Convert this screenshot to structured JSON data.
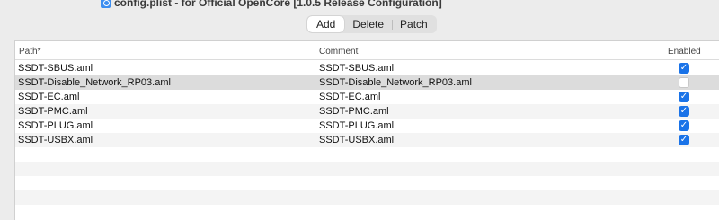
{
  "window": {
    "title": "config.plist - for Official OpenCore [1.0.5 Release Configuration]"
  },
  "tabs": [
    {
      "label": "Add",
      "active": true
    },
    {
      "label": "Delete",
      "active": false
    },
    {
      "label": "Patch",
      "active": false
    }
  ],
  "table": {
    "columns": {
      "path": "Path*",
      "comment": "Comment",
      "enabled": "Enabled"
    },
    "rows": [
      {
        "path": "SSDT-SBUS.aml",
        "comment": "SSDT-SBUS.aml",
        "enabled": true
      },
      {
        "path": "SSDT-Disable_Network_RP03.aml",
        "comment": "SSDT-Disable_Network_RP03.aml",
        "enabled": false
      },
      {
        "path": "SSDT-EC.aml",
        "comment": "SSDT-EC.aml",
        "enabled": true
      },
      {
        "path": "SSDT-PMC.aml",
        "comment": "SSDT-PMC.aml",
        "enabled": true
      },
      {
        "path": "SSDT-PLUG.aml",
        "comment": "SSDT-PLUG.aml",
        "enabled": true
      },
      {
        "path": "SSDT-USBX.aml",
        "comment": "SSDT-USBX.aml",
        "enabled": true
      }
    ]
  },
  "colors": {
    "accent": "#1a73e8",
    "selected_row": "#dcdcdc",
    "alt_row": "#f4f4f4"
  },
  "icons": {
    "title": "plist-file-icon",
    "checkbox": "checkmark-icon"
  }
}
